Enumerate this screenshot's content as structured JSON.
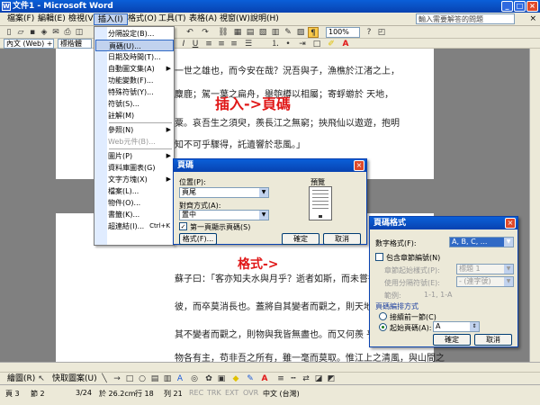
{
  "window": {
    "title": "文件1 - Microsoft Word"
  },
  "menubar": {
    "items": [
      "檔案(F)",
      "編輯(E)",
      "檢視(V)",
      "插入(I)",
      "格式(O)",
      "工具(T)",
      "表格(A)",
      "視窗(W)",
      "說明(H)"
    ],
    "help_placeholder": "輸入需要解答的問題"
  },
  "toolbar": {
    "style": "內文 (Web) +",
    "font": "標楷體",
    "zoom": "100%"
  },
  "insert_menu": {
    "items": [
      {
        "label": "分隔設定(B)...",
        "submenu": false
      },
      {
        "label": "頁碼(U)...",
        "submenu": false,
        "highlighted": true
      },
      {
        "label": "日期及時間(T)...",
        "submenu": false
      },
      {
        "label": "自動圖文集(A)",
        "submenu": true
      },
      {
        "label": "功能變數(F)...",
        "submenu": false
      },
      {
        "label": "特殊符號(Y)...",
        "submenu": false
      },
      {
        "label": "符號(S)...",
        "submenu": false
      },
      {
        "label": "註解(M)",
        "submenu": false
      },
      {
        "label": "參照(N)",
        "submenu": true
      },
      {
        "label": "Web元件(B)...",
        "submenu": false,
        "disabled": true
      },
      {
        "label": "圖片(P)",
        "submenu": true
      },
      {
        "label": "資料庫圖表(G)",
        "submenu": false
      },
      {
        "label": "文字方塊(X)",
        "submenu": true
      },
      {
        "label": "檔案(L)...",
        "submenu": false
      },
      {
        "label": "物件(O)...",
        "submenu": false
      },
      {
        "label": "書籤(K)...",
        "submenu": false
      },
      {
        "label": "超連結(I)...",
        "shortcut": "Ctrl+K",
        "submenu": false
      }
    ]
  },
  "annotations": {
    "insert_page": "插入->頁碼",
    "format": "格式->"
  },
  "document": {
    "top_lines": [
      "一世之雄也，而今安在哉？況吾與子，漁樵於江渚之上，",
      "麋鹿；駕一葉之扁舟，舉匏樽以相屬；寄蜉蝣於 天地，",
      "粟。哀吾生之須臾，羨長江之無窮；挾飛仙以遨遊，抱明",
      "知不可乎驟得，託遺響於悲風。」"
    ],
    "bottom_lines": [
      "蘇子曰：「客亦知夫水與月乎？逝者如斯，而未嘗往也；",
      "彼，而卒莫消長也。蓋將自其變者而觀之，則天地曾不能",
      "其不變者而觀之，則物與我皆無盡也。而又何羨 乎？且夫",
      "物各有主，苟非吾之所有，雖一毫而莫取。惟江上之清風，與山間之"
    ]
  },
  "page_number_dialog": {
    "title": "頁碼",
    "position_label": "位置(P):",
    "position_value": "頁尾",
    "alignment_label": "對齊方式(A):",
    "alignment_value": "置中",
    "first_page_label": "第一頁顯示頁碼(S)",
    "preview_label": "預覽",
    "format_button": "格式(F)...",
    "ok_button": "確定",
    "cancel_button": "取消"
  },
  "page_format_dialog": {
    "title": "頁碼格式",
    "number_format_label": "數字格式(F):",
    "number_format_value": "A, B, C, ...",
    "chapter_label": "包含章節編號(N)",
    "chapter_style_label": "章節起始樣式(P):",
    "chapter_style_value": "標題 1",
    "separator_label": "使用分隔符號(E):",
    "separator_value": "- (連字號)",
    "example_label": "範例:",
    "example_value": "1-1, 1-A",
    "numbering_label": "頁碼編排方式",
    "continue_label": "接續前一節(C)",
    "start_label": "起始頁碼(A):",
    "start_value": "A",
    "ok_button": "確定",
    "cancel_button": "取消"
  },
  "status": {
    "page": "頁 3",
    "section": "節 2",
    "pages": "3/24",
    "at": "於 26.2cm",
    "line": "行 18",
    "col": "列 21",
    "rec": "REC",
    "trk": "TRK",
    "ext": "EXT",
    "ovr": "OVR",
    "lang": "中文 (台灣)"
  },
  "drawbar": {
    "draw": "繪圖(R)",
    "autoshape": "快取圖案(U)"
  }
}
